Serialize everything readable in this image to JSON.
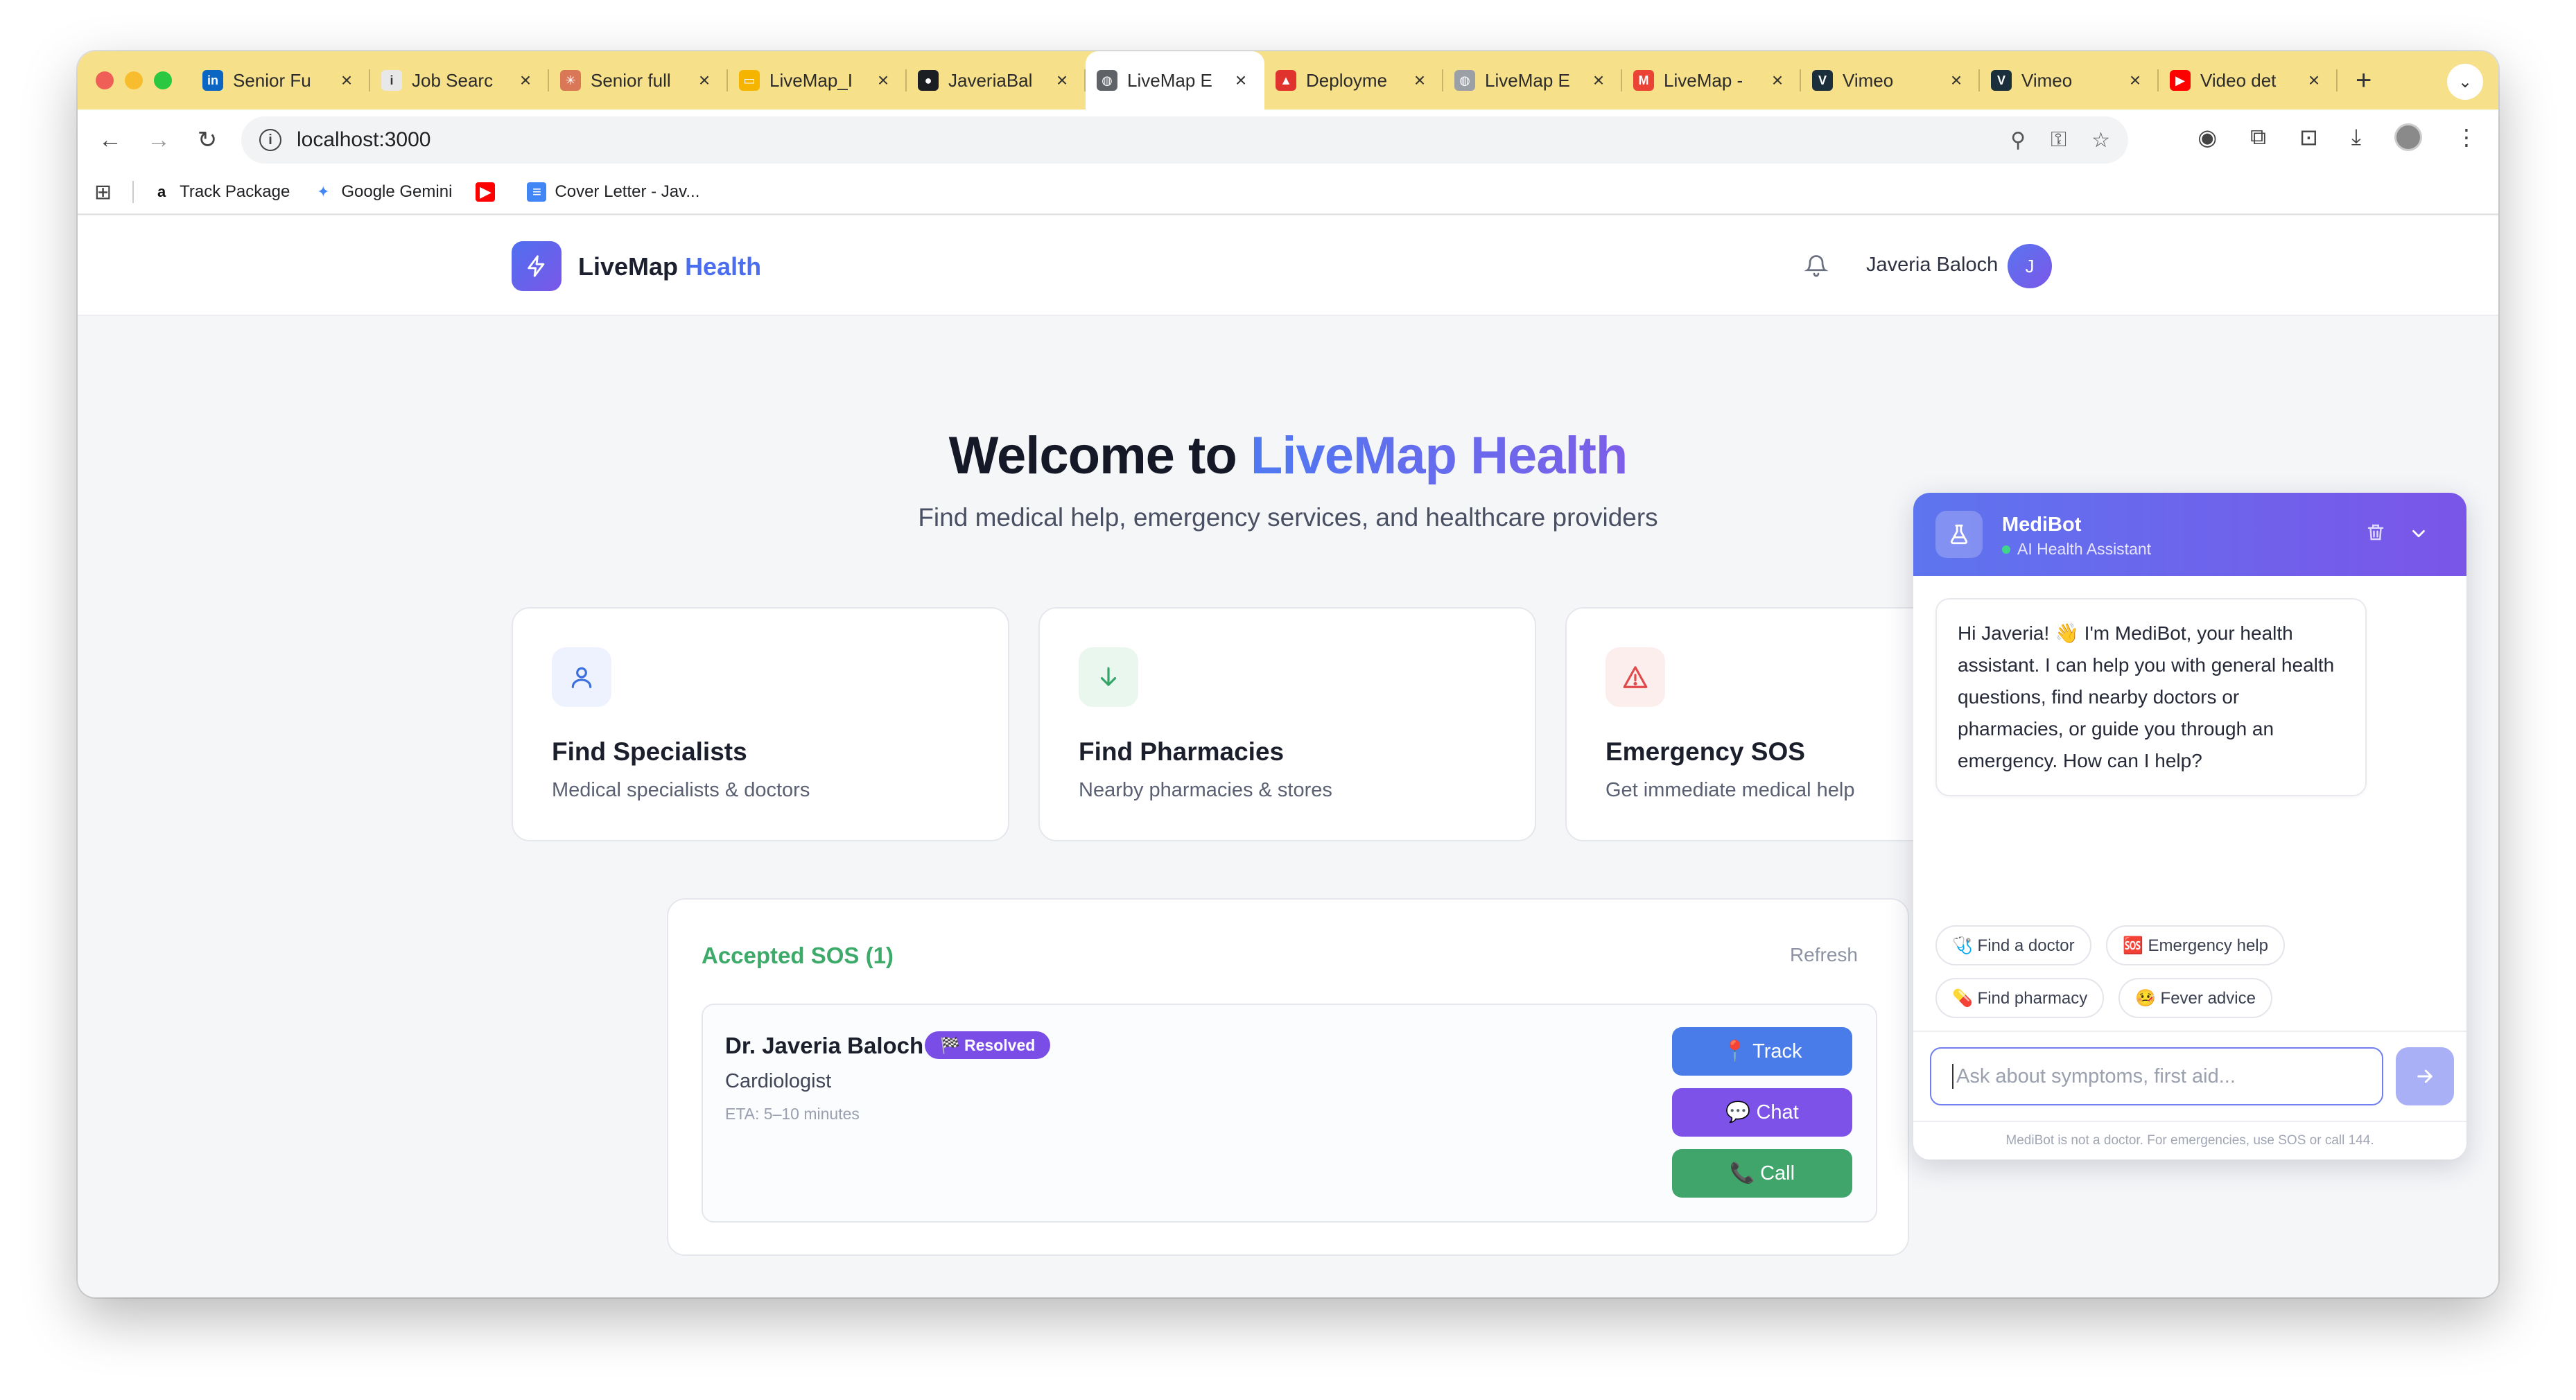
{
  "browser": {
    "tabs": [
      {
        "title": "Senior Fu",
        "fav": "in",
        "fav_bg": "#0a66c2",
        "active": false
      },
      {
        "title": "Job Searc",
        "fav": "i",
        "fav_bg": "#e8e8e8",
        "active": false
      },
      {
        "title": "Senior full",
        "fav": "✳",
        "fav_bg": "#d97757",
        "active": false
      },
      {
        "title": "LiveMap_I",
        "fav": "▭",
        "fav_bg": "#f4b400",
        "active": false
      },
      {
        "title": "JaveriaBal",
        "fav": "●",
        "fav_bg": "#1b1f23",
        "active": false
      },
      {
        "title": "LiveMap E",
        "fav": "◍",
        "fav_bg": "#5f6368",
        "active": true
      },
      {
        "title": "Deployme",
        "fav": "▲",
        "fav_bg": "#e0332e",
        "active": false
      },
      {
        "title": "LiveMap E",
        "fav": "◍",
        "fav_bg": "#9aa0a6",
        "active": false
      },
      {
        "title": "LiveMap -",
        "fav": "M",
        "fav_bg": "#ea4335",
        "active": false
      },
      {
        "title": "Vimeo",
        "fav": "V",
        "fav_bg": "#1a2e3b",
        "active": false
      },
      {
        "title": "Vimeo",
        "fav": "V",
        "fav_bg": "#1a2e3b",
        "active": false
      },
      {
        "title": "Video det",
        "fav": "▶",
        "fav_bg": "#ff0000",
        "active": false
      }
    ],
    "url": "localhost:3000",
    "bookmarks": [
      {
        "label": "Track Package",
        "fav": "a",
        "fav_bg": "#ffffff",
        "fav_color": "#111"
      },
      {
        "label": "Google Gemini",
        "fav": "✦",
        "fav_bg": "#ffffff",
        "fav_color": "#4285f4"
      },
      {
        "label": "",
        "fav": "▶",
        "fav_bg": "#ff0000",
        "fav_color": "#fff"
      },
      {
        "label": "Cover Letter - Jav...",
        "fav": "≡",
        "fav_bg": "#4285f4",
        "fav_color": "#fff"
      }
    ]
  },
  "app": {
    "logo_main": "LiveMap",
    "logo_accent": "Health",
    "user_name": "Javeria Baloch",
    "user_initial": "J",
    "hero_title_prefix": "Welcome to",
    "hero_title_accent": "LiveMap Health",
    "hero_subtitle": "Find medical help, emergency services, and healthcare providers",
    "cards": [
      {
        "title": "Find Specialists",
        "desc": "Medical specialists & doctors",
        "icon": "user-icon",
        "color": "#3b6fe0",
        "bg": "#edf2fe"
      },
      {
        "title": "Find Pharmacies",
        "desc": "Nearby pharmacies & stores",
        "icon": "arrow-down-icon",
        "color": "#35a467",
        "bg": "#eaf7ef"
      },
      {
        "title": "Emergency SOS",
        "desc": "Get immediate medical help",
        "icon": "alert-triangle-icon",
        "color": "#e04a4a",
        "bg": "#fdeeee"
      }
    ],
    "sos": {
      "title": "Accepted SOS (1)",
      "refresh_label": "Refresh",
      "doctor": "Dr. Javeria Baloch",
      "badge": "🏁 Resolved",
      "specialty": "Cardiologist",
      "eta": "ETA: 5–10 minutes",
      "track_label": "📍 Track",
      "chat_label": "💬 Chat",
      "call_label": "📞 Call"
    }
  },
  "medibot": {
    "name": "MediBot",
    "status": "AI Health Assistant",
    "message": "Hi Javeria! 👋 I'm MediBot, your health assistant. I can help you with general health questions, find nearby doctors or pharmacies, or guide you through an emergency. How can I help?",
    "chips": [
      "🩺 Find a doctor",
      "🆘 Emergency help",
      "💊 Find pharmacy",
      "🤒 Fever advice"
    ],
    "input_placeholder": "Ask about symptoms, first aid...",
    "footer": "MediBot is not a doctor. For emergencies, use SOS or call 144."
  }
}
